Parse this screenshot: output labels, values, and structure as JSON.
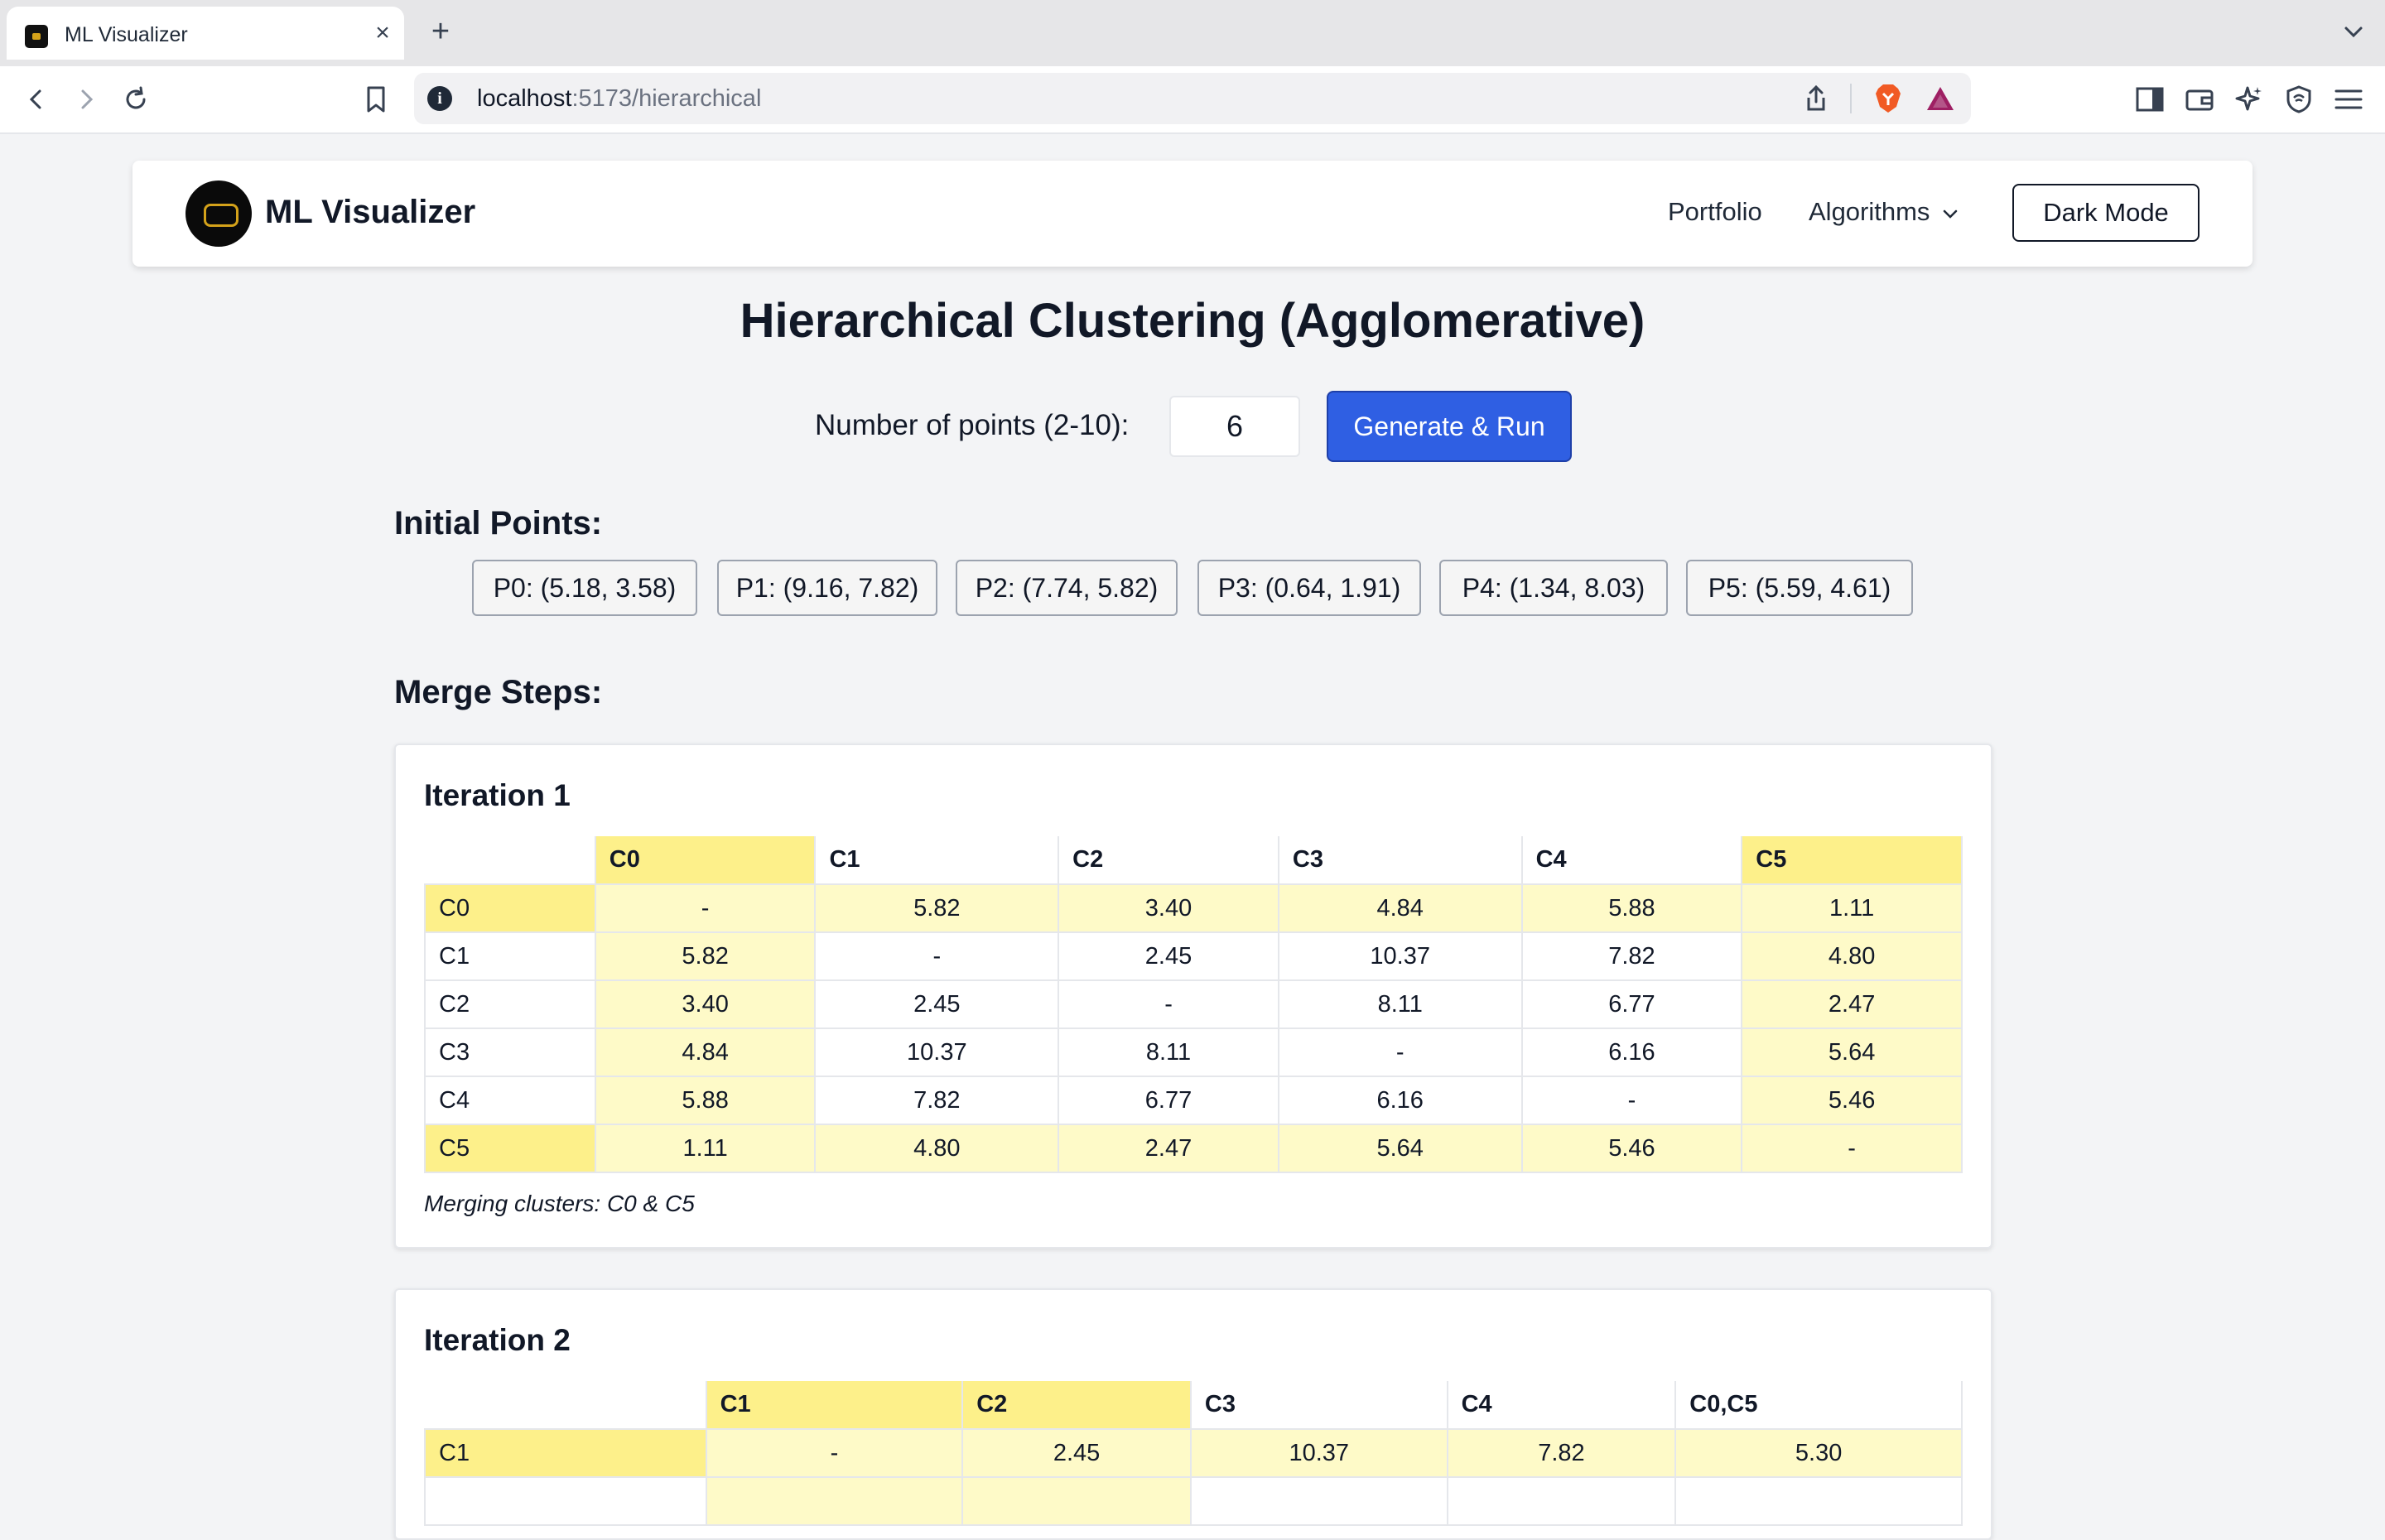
{
  "browser": {
    "tab_title": "ML Visualizer",
    "url_host": "localhost",
    "url_path": ":5173/hierarchical"
  },
  "nav": {
    "brand": "ML Visualizer",
    "portfolio": "Portfolio",
    "algorithms": "Algorithms",
    "dark_mode": "Dark Mode"
  },
  "page": {
    "title": "Hierarchical Clustering (Agglomerative)",
    "points_label": "Number of points (2-10):",
    "points_value": "6",
    "run_button": "Generate & Run",
    "initial_points_title": "Initial Points:",
    "merge_steps_title": "Merge Steps:"
  },
  "points": [
    "P0: (5.18, 3.58)",
    "P1: (9.16, 7.82)",
    "P2: (7.74, 5.82)",
    "P3: (0.64, 1.91)",
    "P4: (1.34, 8.03)",
    "P5: (5.59, 4.61)"
  ],
  "iterations": [
    {
      "title": "Iteration 1",
      "columns": [
        "C0",
        "C1",
        "C2",
        "C3",
        "C4",
        "C5"
      ],
      "highlight": [
        "C0",
        "C5"
      ],
      "rows": [
        {
          "label": "C0",
          "values": [
            "-",
            "5.82",
            "3.40",
            "4.84",
            "5.88",
            "1.11"
          ]
        },
        {
          "label": "C1",
          "values": [
            "5.82",
            "-",
            "2.45",
            "10.37",
            "7.82",
            "4.80"
          ]
        },
        {
          "label": "C2",
          "values": [
            "3.40",
            "2.45",
            "-",
            "8.11",
            "6.77",
            "2.47"
          ]
        },
        {
          "label": "C3",
          "values": [
            "4.84",
            "10.37",
            "8.11",
            "-",
            "6.16",
            "5.64"
          ]
        },
        {
          "label": "C4",
          "values": [
            "5.88",
            "7.82",
            "6.77",
            "6.16",
            "-",
            "5.46"
          ]
        },
        {
          "label": "C5",
          "values": [
            "1.11",
            "4.80",
            "2.47",
            "5.64",
            "5.46",
            "-"
          ]
        }
      ],
      "merge_text": "Merging clusters: C0 & C5"
    },
    {
      "title": "Iteration 2",
      "columns": [
        "C1",
        "C2",
        "C3",
        "C4",
        "C0,C5"
      ],
      "highlight": [
        "C1",
        "C2"
      ],
      "rows": [
        {
          "label": "C1",
          "values": [
            "-",
            "2.45",
            "10.37",
            "7.82",
            "5.30"
          ]
        }
      ],
      "merge_text": ""
    }
  ]
}
